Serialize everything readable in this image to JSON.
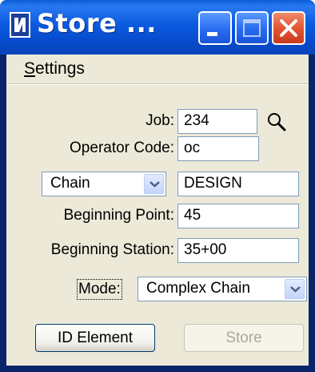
{
  "window": {
    "title": "Store ...",
    "controls": {
      "minimize": "minimize",
      "maximize": "maximize",
      "close": "close"
    }
  },
  "menu": {
    "settings_prefix": "S",
    "settings_rest": "ettings"
  },
  "form": {
    "job_label": "Job:",
    "job_value": "234",
    "operator_label": "Operator Code:",
    "operator_value": "oc",
    "type_select_value": "Chain",
    "type_name_value": "DESIGN",
    "begin_point_label": "Beginning Point:",
    "begin_point_value": "45",
    "begin_station_label": "Beginning Station:",
    "begin_station_value": "35+00",
    "mode_label": "Mode:",
    "mode_value": "Complex Chain"
  },
  "buttons": {
    "id_element": "ID Element",
    "store": "Store"
  },
  "colors": {
    "titlebar": "#0a5fd8",
    "close_button": "#e0532f",
    "dialog_background": "#ece9d8",
    "field_border": "#7f9db9"
  },
  "icons": [
    "app-icon",
    "minimize-icon",
    "maximize-icon",
    "close-icon",
    "search-icon",
    "chevron-down-icon"
  ]
}
